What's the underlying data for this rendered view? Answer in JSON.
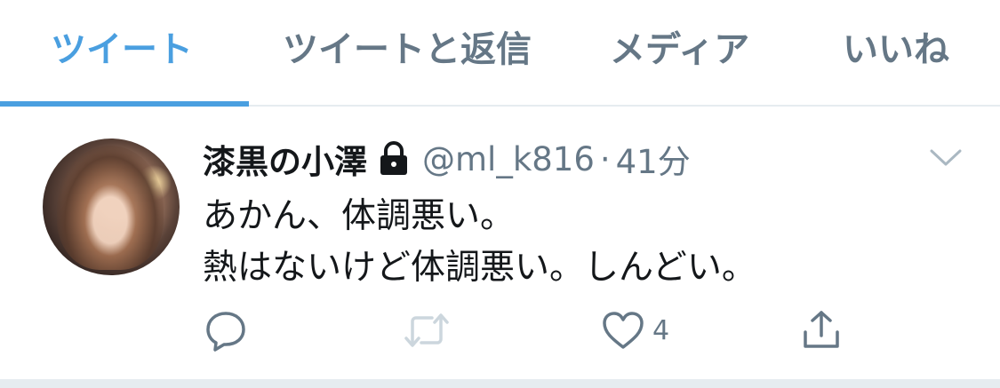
{
  "tabs": [
    {
      "label": "ツイート",
      "active": true
    },
    {
      "label": "ツイートと返信",
      "active": false
    },
    {
      "label": "メディア",
      "active": false
    },
    {
      "label": "いいね",
      "active": false
    }
  ],
  "tweet": {
    "display_name": "漆黒の小澤",
    "handle": "@ml_k816",
    "separator": "·",
    "time": "41分",
    "protected_icon": "lock-icon",
    "text_lines": [
      "あかん、体調悪い。",
      "熱はないけど体調悪い。しんどい。"
    ],
    "actions": {
      "reply_icon": "reply-icon",
      "retweet_icon": "retweet-icon",
      "like_icon": "heart-icon",
      "like_count": "4",
      "share_icon": "share-icon"
    }
  },
  "colors": {
    "accent": "#4a9fe0",
    "secondary_text": "#657786",
    "primary_text": "#14171a",
    "divider": "#e6ecf0"
  }
}
